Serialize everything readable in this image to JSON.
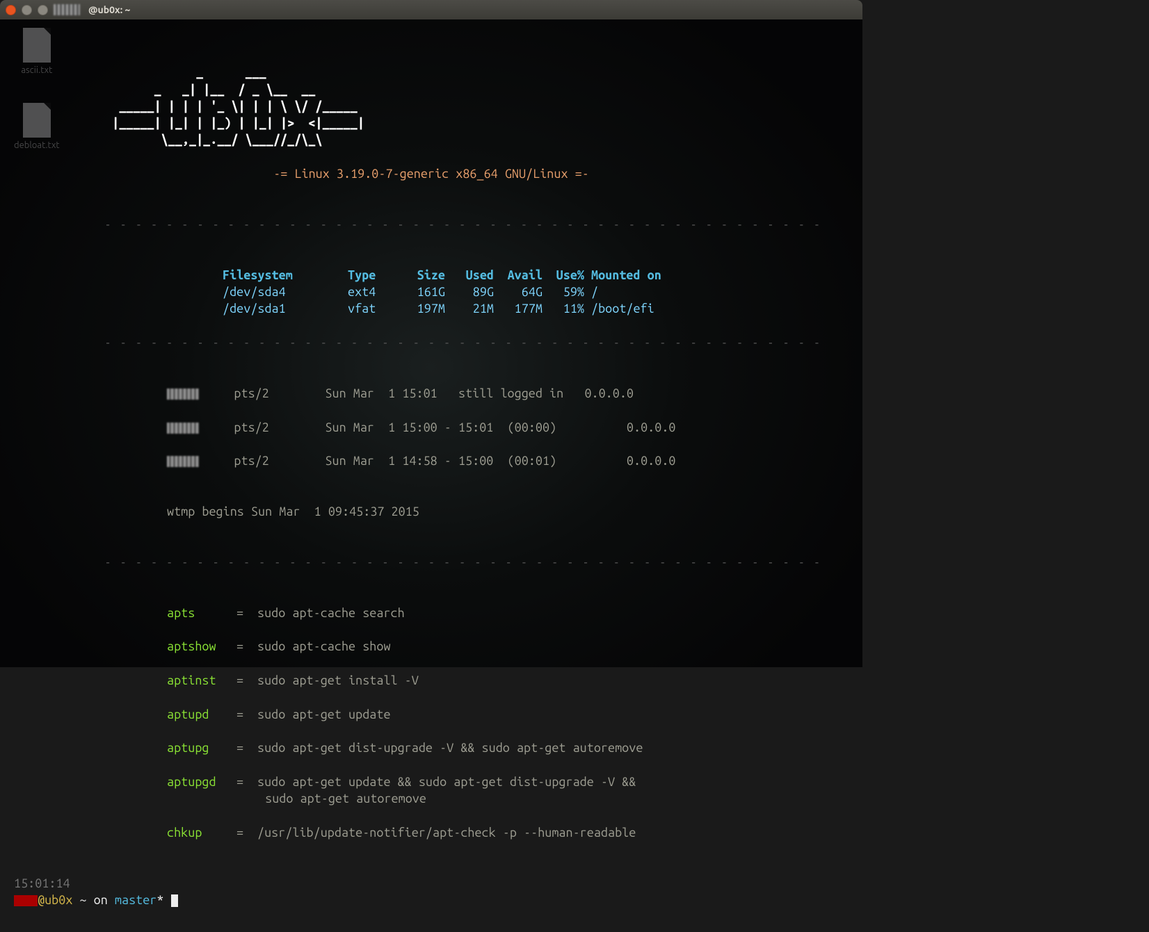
{
  "window": {
    "title": "@ub0x: ~"
  },
  "desktop": {
    "files": [
      "ascii.txt",
      "debloat.txt"
    ]
  },
  "motd": {
    "ascii": "           _      ___\n     _   _| |__  / _ \\__  __\n ___| | | | '_ \\| | | \\ \\/ /___\n|___| |_| | |_) | |_| |>  <|___|\n     \\__,_|_.__/ \\___//_/\\_\\",
    "kernel": "-= Linux 3.19.0-7-generic x86_64 GNU/Linux =-",
    "divider": "- - - - - - - - - - - - - - - - - - - - - - - - - - - - - - - - - - - - - - - - - - - - - - -"
  },
  "fs": {
    "headers": {
      "fs": "Filesystem",
      "type": "Type",
      "size": "Size",
      "used": "Used",
      "avail": "Avail",
      "usep": "Use%",
      "mount": "Mounted on"
    },
    "rows": [
      {
        "fs": "/dev/sda4",
        "type": "ext4",
        "size": "161G",
        "used": "89G",
        "avail": "64G",
        "usep": "59%",
        "mount": "/"
      },
      {
        "fs": "/dev/sda1",
        "type": "vfat",
        "size": "197M",
        "used": "21M",
        "avail": "177M",
        "usep": "11%",
        "mount": "/boot/efi"
      }
    ]
  },
  "last": {
    "rows": [
      {
        "tty": "pts/2",
        "date": "Sun Mar  1 15:01",
        "status": "still logged in",
        "ip": "0.0.0.0"
      },
      {
        "tty": "pts/2",
        "date": "Sun Mar  1 15:00 - 15:01",
        "status": "(00:00)",
        "ip": "0.0.0.0"
      },
      {
        "tty": "pts/2",
        "date": "Sun Mar  1 14:58 - 15:00",
        "status": "(00:01)",
        "ip": "0.0.0.0"
      }
    ],
    "wtmp": "wtmp begins Sun Mar  1 09:45:37 2015"
  },
  "aliases": [
    {
      "name": "apts",
      "eq": "=",
      "cmd": "sudo apt-cache search"
    },
    {
      "name": "aptshow",
      "eq": "=",
      "cmd": "sudo apt-cache show"
    },
    {
      "name": "aptinst",
      "eq": "=",
      "cmd": "sudo apt-get install -V"
    },
    {
      "name": "aptupd",
      "eq": "=",
      "cmd": "sudo apt-get update"
    },
    {
      "name": "aptupg",
      "eq": "=",
      "cmd": "sudo apt-get dist-upgrade -V && sudo apt-get autoremove"
    },
    {
      "name": "aptupgd",
      "eq": "=",
      "cmd": "sudo apt-get update && sudo apt-get dist-upgrade -V &&\n              sudo apt-get autoremove"
    },
    {
      "name": "chkup",
      "eq": "=",
      "cmd": "/usr/lib/update-notifier/apt-check -p --human-readable"
    }
  ],
  "prompt": {
    "time": "15:01:14",
    "at": "@",
    "host": "ub0x",
    "path": " ~ ",
    "on": "on ",
    "branch": "master",
    "dirty": "* "
  }
}
